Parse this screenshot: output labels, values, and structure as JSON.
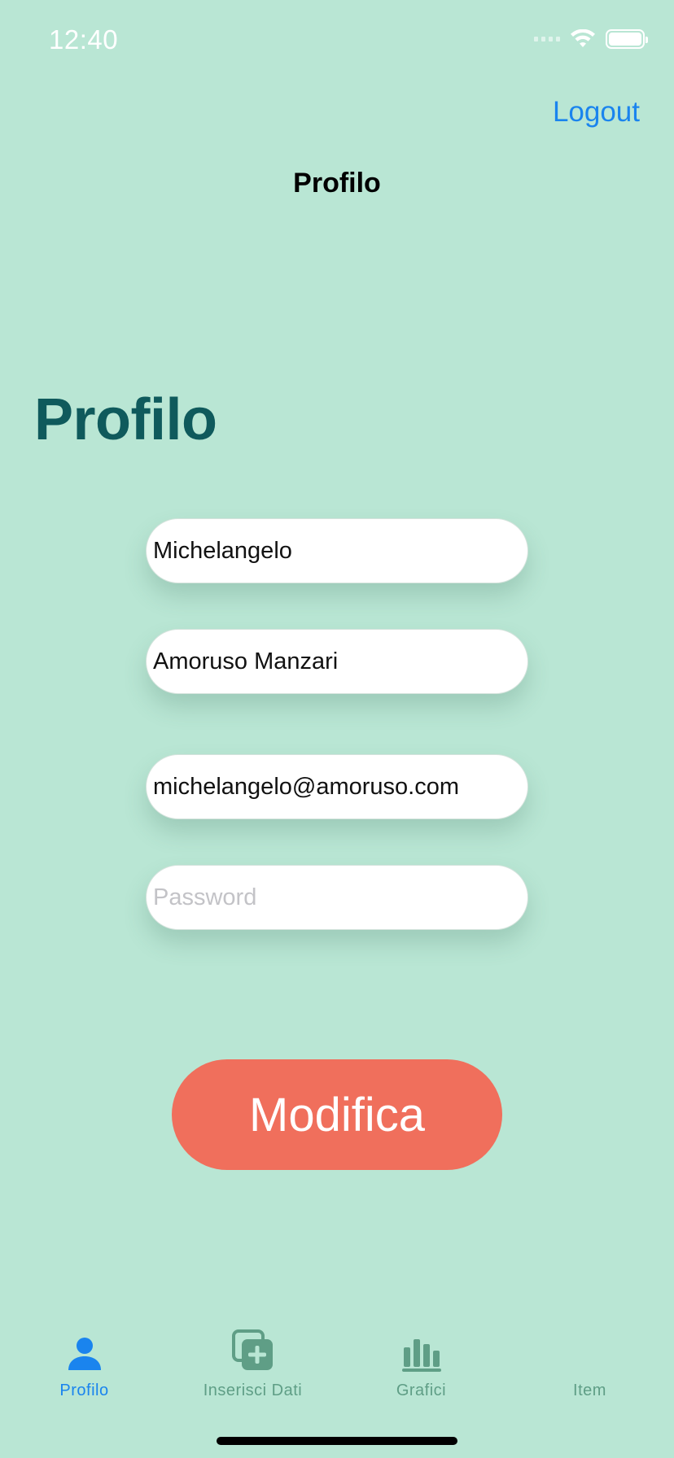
{
  "status_bar": {
    "time": "12:40"
  },
  "nav": {
    "title": "Profilo",
    "logout_label": "Logout"
  },
  "page": {
    "title": "Profilo"
  },
  "form": {
    "first_name": "Michelangelo",
    "last_name": "Amoruso Manzari",
    "email": "michelangelo@amoruso.com",
    "password": "",
    "password_placeholder": "Password"
  },
  "submit_label": "Modifica",
  "tabs": [
    {
      "label": "Profilo",
      "icon": "person-icon",
      "active": true
    },
    {
      "label": "Inserisci Dati",
      "icon": "add-data-icon",
      "active": false
    },
    {
      "label": "Grafici",
      "icon": "bar-chart-icon",
      "active": false
    },
    {
      "label": "Item",
      "icon": "",
      "active": false
    }
  ],
  "colors": {
    "background": "#b9e6d4",
    "accent": "#1a84ee",
    "title": "#0f5a5c",
    "button": "#f06f5c",
    "tab_inactive": "#5f9e86"
  }
}
